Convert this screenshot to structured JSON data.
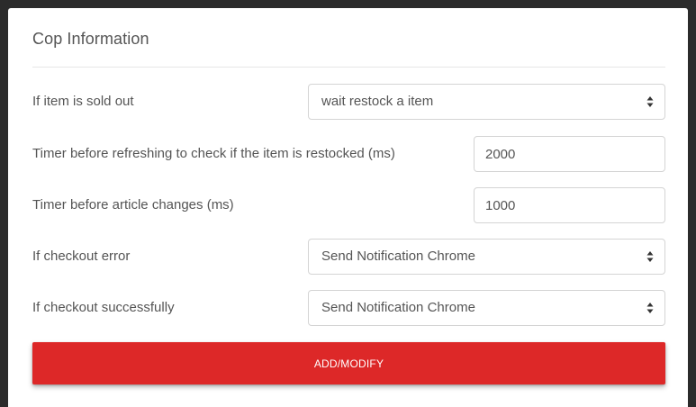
{
  "card": {
    "title": "Cop Information"
  },
  "fields": {
    "sold_out": {
      "label": "If item is sold out",
      "selected": "wait restock a item"
    },
    "restock_timer": {
      "label": "Timer before refreshing to check if the item is restocked (ms)",
      "value": "2000"
    },
    "article_timer": {
      "label": "Timer before article changes (ms)",
      "value": "1000"
    },
    "checkout_error": {
      "label": "If checkout error",
      "selected": "Send Notification Chrome"
    },
    "checkout_success": {
      "label": "If checkout successfully",
      "selected": "Send Notification Chrome"
    }
  },
  "actions": {
    "submit_label": "ADD/MODIFY"
  },
  "colors": {
    "accent": "#dd2828",
    "background": "#2b2b2b",
    "card": "#ffffff",
    "text": "#555555",
    "border": "#d4d4d4"
  },
  "icons": {
    "select_arrow": "sort-arrows-icon"
  }
}
